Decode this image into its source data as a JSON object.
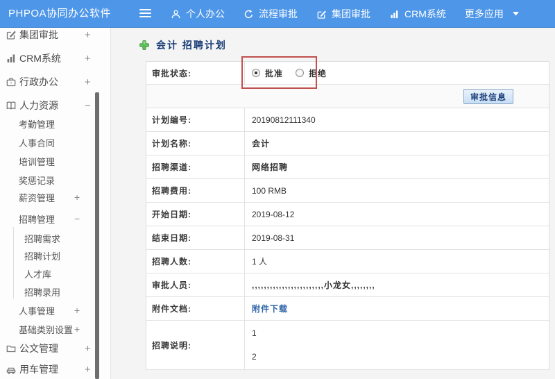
{
  "colors": {
    "header_blue": "#4d96e8",
    "title_navy": "#1c3f77",
    "annotation_red": "#c0504d",
    "link_blue": "#2e64a8"
  },
  "header": {
    "logo": "PHPOA协同办公软件",
    "nav": [
      {
        "label": "个人办公",
        "icon": "person-icon"
      },
      {
        "label": "流程审批",
        "icon": "history-icon"
      },
      {
        "label": "集团审批",
        "icon": "edit-icon"
      },
      {
        "label": "CRM系统",
        "icon": "bar-chart-icon"
      },
      {
        "label": "更多应用",
        "icon": "caret-down-icon"
      }
    ]
  },
  "sidebar": {
    "items": [
      {
        "label": "集团审批",
        "icon": "edit-square-icon",
        "expand": "+",
        "level": 0
      },
      {
        "label": "CRM系统",
        "icon": "bar-chart-icon",
        "expand": "+",
        "level": 0
      },
      {
        "label": "行政办公",
        "icon": "briefcase-icon",
        "expand": "+",
        "level": 0
      },
      {
        "label": "人力资源",
        "icon": "book-icon",
        "expand": "−",
        "level": 0
      },
      {
        "label": "考勤管理",
        "level": 1
      },
      {
        "label": "人事合同",
        "level": 1
      },
      {
        "label": "培训管理",
        "level": 1
      },
      {
        "label": "奖惩记录",
        "level": 1
      },
      {
        "label": "薪资管理",
        "expand": "+",
        "level": 1
      },
      {
        "label": "招聘管理",
        "expand": "−",
        "level": 1
      },
      {
        "label": "招聘需求",
        "level": 2
      },
      {
        "label": "招聘计划",
        "level": 2
      },
      {
        "label": "人才库",
        "level": 2
      },
      {
        "label": "招聘录用",
        "level": 2
      },
      {
        "label": "人事管理",
        "expand": "+",
        "level": 1
      },
      {
        "label": "基础类别设置",
        "expand": "+",
        "level": 1
      },
      {
        "label": "公文管理",
        "icon": "document-icon",
        "expand": "+",
        "level": 0
      },
      {
        "label": "用车管理",
        "icon": "car-icon",
        "expand": "+",
        "level": 0
      }
    ]
  },
  "main": {
    "title": "会计 招聘计划",
    "form": {
      "status_label": "审批状态:",
      "radio_approve": "批准",
      "radio_reject": "拒绝",
      "approve_selected": true,
      "info_button": "审批信息",
      "rows": [
        {
          "label": "计划编号:",
          "value": "20190812111340"
        },
        {
          "label": "计划名称:",
          "value": "会计"
        },
        {
          "label": "招聘渠道:",
          "value": "网络招聘"
        },
        {
          "label": "招聘费用:",
          "value": "100 RMB"
        },
        {
          "label": "开始日期:",
          "value": "2019-08-12"
        },
        {
          "label": "结束日期:",
          "value": "2019-08-31"
        },
        {
          "label": "招聘人数:",
          "value": "1 人"
        },
        {
          "label": "审批人员:",
          "value": ",,,,,,,,,,,,,,,,,,,,,,,,小龙女,,,,,,,,"
        },
        {
          "label": "附件文档:",
          "value": "附件下载"
        },
        {
          "label": "招聘说明:",
          "line1": "1",
          "line2": "2"
        }
      ]
    }
  }
}
